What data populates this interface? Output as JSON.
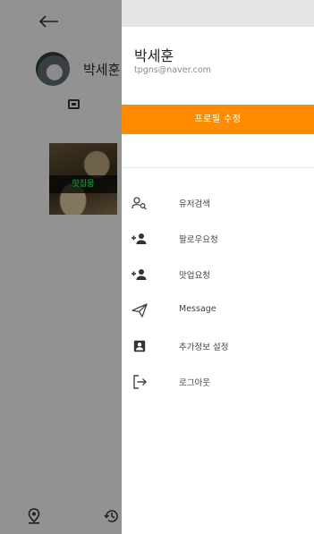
{
  "background": {
    "profile_name": "박세훈",
    "thumbnail_caption": "맛집몽"
  },
  "drawer": {
    "user_name": "박세훈",
    "user_email": "tpgns@naver.com",
    "edit_profile_label": "프로필 수정",
    "accent_color": "#ff8c00",
    "menu": [
      {
        "icon": "user-search-icon",
        "label": "유저검색"
      },
      {
        "icon": "person-add-icon",
        "label": "팔로우요청"
      },
      {
        "icon": "person-add-icon",
        "label": "맛업요청"
      },
      {
        "icon": "send-icon",
        "label": "Message"
      },
      {
        "icon": "account-box-icon",
        "label": "추가정보 설정"
      },
      {
        "icon": "logout-icon",
        "label": "로그아웃"
      }
    ]
  }
}
